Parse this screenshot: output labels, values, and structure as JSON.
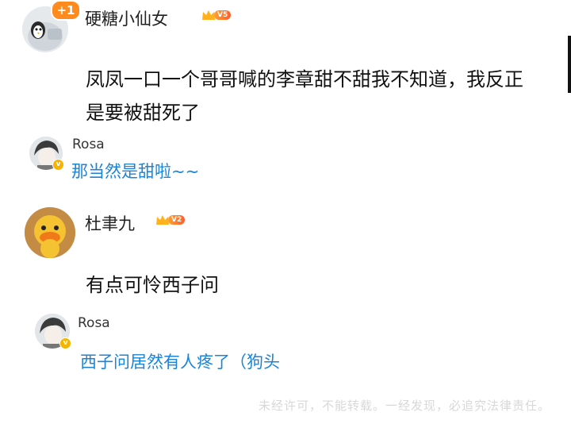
{
  "comments": [
    {
      "user": "硬糖小仙女",
      "vip_level": "V5",
      "like_badge": "+1",
      "text": "凤凤一口一个哥哥喊的李章甜不甜我不知道，我反正是要被甜死了",
      "reply": {
        "user": "Rosa",
        "text": "那当然是甜啦~~"
      }
    },
    {
      "user": "杜聿九",
      "vip_level": "V2",
      "text": "有点可怜西子问",
      "reply": {
        "user": "Rosa",
        "text": "西子问居然有人疼了（狗头"
      }
    }
  ],
  "watermark": "未经许可，不能转载。一经发现，必追究法律责任。",
  "colors": {
    "reply_text": "#1a84d8",
    "vip_badge": "#ff7a2e",
    "verified_badge": "#f5b400",
    "like_badge": "#ff8a1d"
  }
}
